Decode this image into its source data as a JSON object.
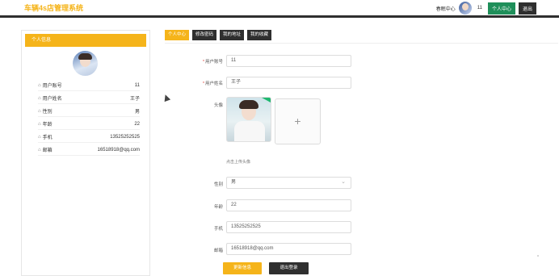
{
  "header": {
    "brand": "车辆4s店管理系统",
    "spring_link": "春眠中心",
    "username": "11",
    "personal_center_button": "个人中心",
    "logout_button": "退出"
  },
  "left_panel": {
    "title": "个人信息",
    "rows": [
      {
        "icon": "user-icon",
        "label": "用户账号",
        "value": "11"
      },
      {
        "icon": "user-icon",
        "label": "用户姓名",
        "value": "王子"
      },
      {
        "icon": "user-icon",
        "label": "性别",
        "value": "男"
      },
      {
        "icon": "user-icon",
        "label": "年龄",
        "value": "22"
      },
      {
        "icon": "user-icon",
        "label": "手机",
        "value": "13525252525"
      },
      {
        "icon": "user-icon",
        "label": "邮箱",
        "value": "16518918@qq.com"
      }
    ]
  },
  "tabs": [
    {
      "label": "个人中心",
      "active": true
    },
    {
      "label": "修改密码",
      "active": false
    },
    {
      "label": "我的地址",
      "active": false
    },
    {
      "label": "我的收藏",
      "active": false
    }
  ],
  "form": {
    "account_label": "用户账号",
    "account_value": "11",
    "name_label": "用户姓名",
    "name_value": "王子",
    "avatar_label": "头像",
    "upload_tip": "点击上传头像",
    "gender_label": "性别",
    "gender_value": "男",
    "age_label": "年龄",
    "age_value": "22",
    "phone_label": "手机",
    "phone_value": "13525252525",
    "email_label": "邮箱",
    "email_value": "16518918@qq.com",
    "update_button": "更新信息",
    "logout_button": "退出登录"
  },
  "colors": {
    "accent": "#f5b41a",
    "dark": "#2f2f2f",
    "green": "#1f8f5a",
    "required": "#e0463c"
  }
}
